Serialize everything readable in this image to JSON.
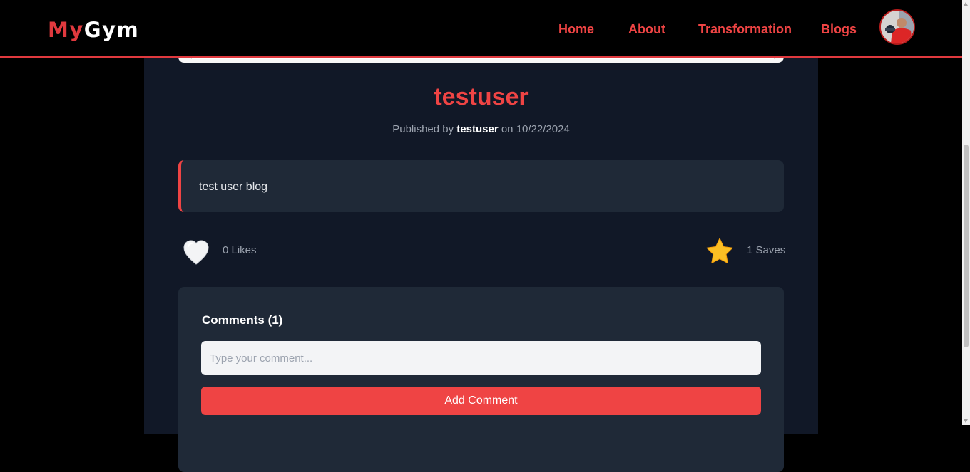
{
  "nav": {
    "logo_my": "My",
    "logo_gym": "Gym",
    "links": [
      "Home",
      "About",
      "Transformation",
      "Blogs"
    ]
  },
  "post": {
    "title": "testuser",
    "published_prefix": "Published by ",
    "author": "testuser",
    "date_prefix": " on ",
    "date": "10/22/2024",
    "body": "test user blog",
    "likes_text": "0 Likes",
    "saves_text": "1 Saves"
  },
  "comments": {
    "heading": "Comments (1)",
    "placeholder": "Type your comment...",
    "add_label": "Add Comment"
  },
  "colors": {
    "accent": "#ef4444",
    "background": "#000000",
    "card": "#111827",
    "panel": "#1f2937",
    "star": "#fbbf24"
  },
  "icons": {
    "like": "heart-icon",
    "save": "star-icon"
  }
}
